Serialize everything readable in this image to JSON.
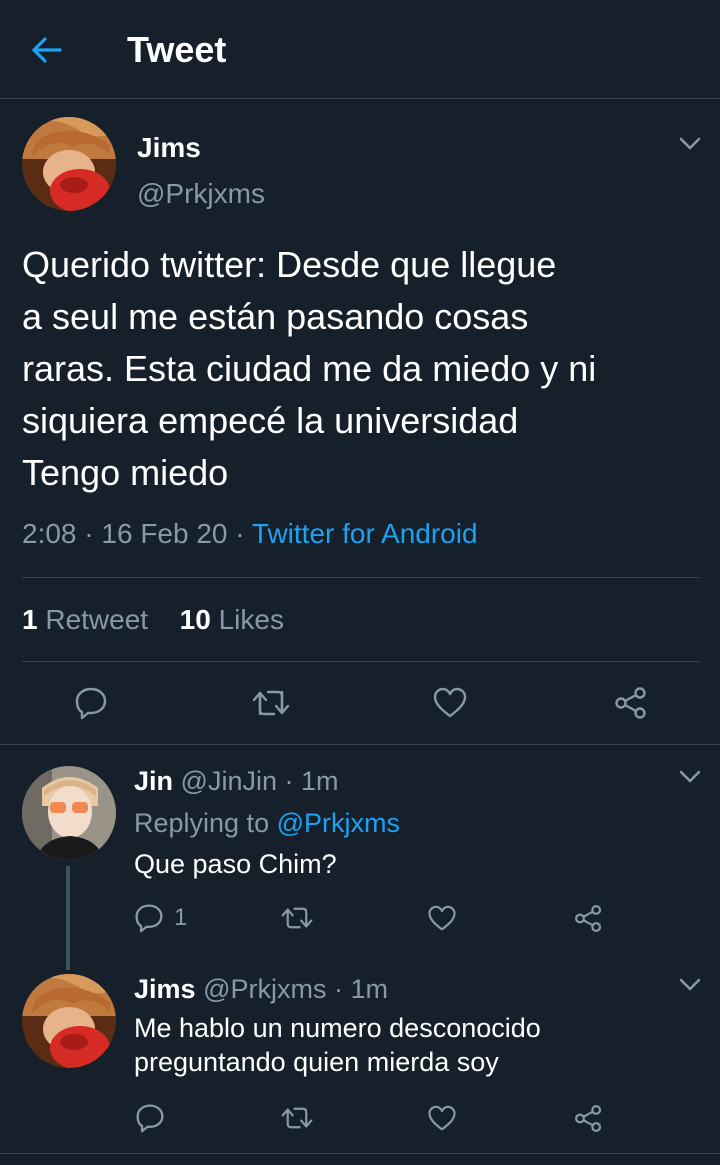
{
  "header": {
    "title": "Tweet"
  },
  "tweet": {
    "name": "Jims",
    "handle": "@Prkjxms",
    "text": "Querido twitter: Desde que llegue\na seul me están pasando cosas\nraras. Esta ciudad me da miedo y ni\nsiquiera empecé la universidad\nTengo miedo",
    "time": "2:08",
    "date": "16 Feb 20",
    "source": "Twitter for Android",
    "retweet_count": "1",
    "retweet_label": "Retweet",
    "like_count": "10",
    "like_label": "Likes"
  },
  "replies": [
    {
      "name": "Jin",
      "handle": "@JinJin",
      "time": "1m",
      "replying_prefix": "Replying to",
      "replying_to": "@Prkjxms",
      "text": "Que paso Chim?",
      "reply_count": "1"
    },
    {
      "name": "Jims",
      "handle": "@Prkjxms",
      "time": "1m",
      "text": "Me hablo un numero desconocido\npreguntando quien mierda soy"
    }
  ],
  "icons": {
    "back": "arrow-left-icon",
    "chevron": "chevron-down-icon",
    "reply": "speech-bubble-icon",
    "retweet": "retweet-icon",
    "like": "heart-icon",
    "share": "share-icon"
  },
  "colors": {
    "background": "#15202b",
    "accent": "#1da1f2",
    "muted": "#8899a6",
    "divider": "#38444d"
  }
}
